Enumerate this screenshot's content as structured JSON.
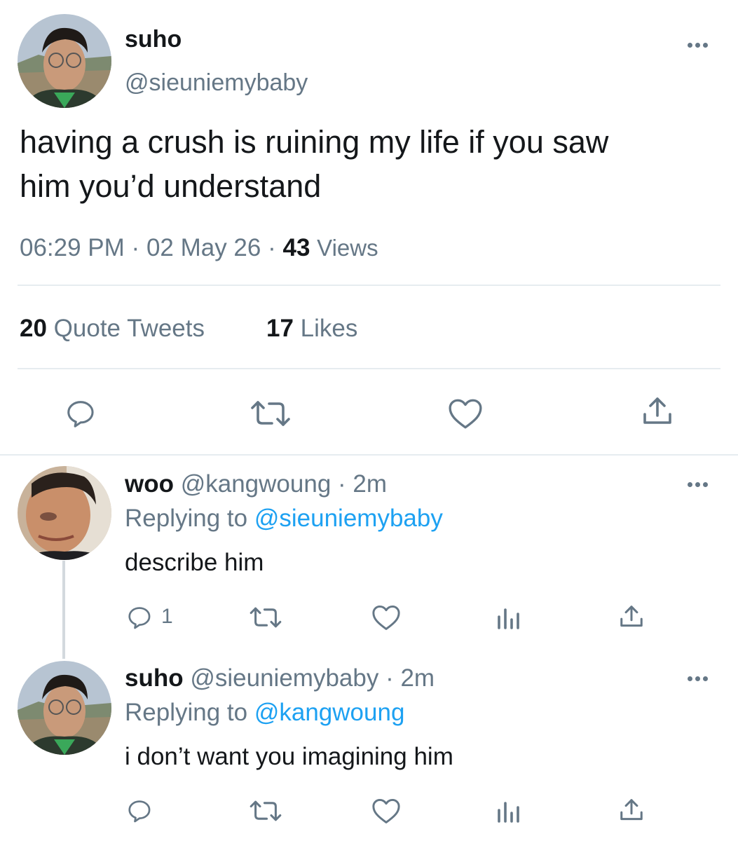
{
  "main_tweet": {
    "display_name": "suho",
    "handle": "@sieuniemybaby",
    "text_line1": "having a crush is ruining my life if you saw",
    "text_line2": "him you’d understand",
    "time": "06:29 PM",
    "separator1": "·",
    "date": "02 May 26",
    "separator2": "·",
    "views_count": "43",
    "views_label": "Views",
    "quote_tweets_count": "20",
    "quote_tweets_label": "Quote Tweets",
    "likes_count": "17",
    "likes_label": "Likes",
    "actions": [
      "reply-icon",
      "retweet-icon",
      "like-icon",
      "share-icon"
    ]
  },
  "replies": [
    {
      "display_name": "woo",
      "handle": "@kangwoung",
      "dot": "·",
      "time": "2m",
      "replying_prefix": "Replying to",
      "replying_handle": "@sieuniemybaby",
      "text": "describe him",
      "reply_count": "1",
      "actions": [
        "reply-icon",
        "retweet-icon",
        "like-icon",
        "analytics-icon",
        "share-icon"
      ]
    },
    {
      "display_name": "suho",
      "handle": "@sieuniemybaby",
      "dot": "·",
      "time": "2m",
      "replying_prefix": "Replying to",
      "replying_handle": "@kangwoung",
      "text": "i don’t want you imagining him",
      "reply_count": "",
      "actions": [
        "reply-icon",
        "retweet-icon",
        "like-icon",
        "analytics-icon",
        "share-icon"
      ]
    }
  ],
  "colors": {
    "text": "#14171a",
    "secondary": "#657786",
    "link": "#1da1f2",
    "divider": "#e6ecf0"
  }
}
